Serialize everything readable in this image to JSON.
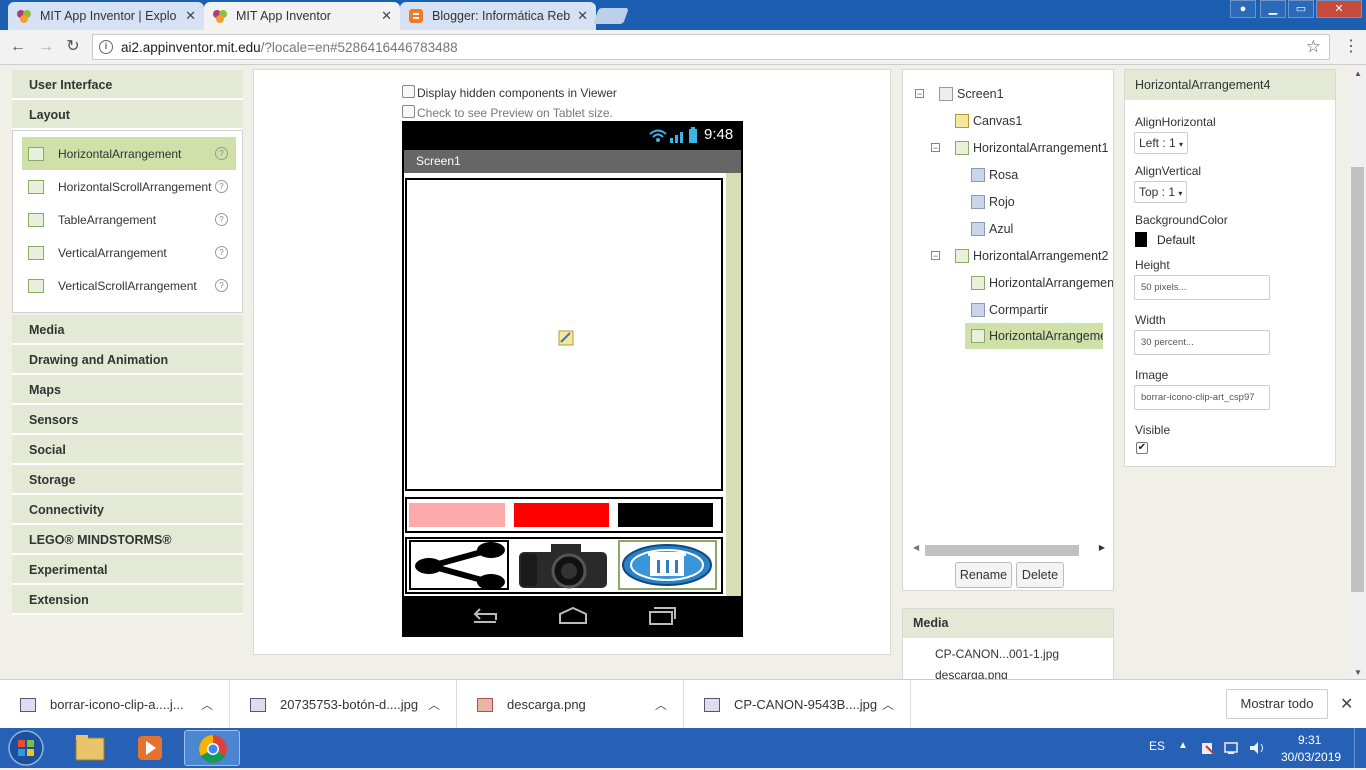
{
  "browser": {
    "tabs": [
      {
        "title": "MIT App Inventor | Explo",
        "active": false
      },
      {
        "title": "MIT App Inventor",
        "active": true
      },
      {
        "title": "Blogger: Informática Reb",
        "active": false
      }
    ],
    "url_host": "ai2.appinventor.mit.edu",
    "url_rest": "/?locale=en#5286416446783488"
  },
  "palette": {
    "categories_top": [
      "User Interface",
      "Layout"
    ],
    "layout_items": [
      "HorizontalArrangement",
      "HorizontalScrollArrangement",
      "TableArrangement",
      "VerticalArrangement",
      "VerticalScrollArrangement"
    ],
    "help_glyph": "?",
    "categories_bottom": [
      "Media",
      "Drawing and Animation",
      "Maps",
      "Sensors",
      "Social",
      "Storage",
      "Connectivity",
      "LEGO® MINDSTORMS®",
      "Experimental",
      "Extension"
    ]
  },
  "viewer": {
    "display_hidden": "Display hidden components in Viewer",
    "tablet_preview": "Check to see Preview on Tablet size.",
    "phone_time": "9:48",
    "screen_title": "Screen1",
    "button_colors": [
      "#ffaaaa",
      "#ff0000",
      "#000000"
    ]
  },
  "tree": {
    "nodes": [
      "Screen1",
      "Canvas1",
      "HorizontalArrangement1",
      "Rosa",
      "Rojo",
      "Azul",
      "HorizontalArrangement2",
      "HorizontalArrangemen",
      "Cormpartir",
      "HorizontalArrangemen"
    ],
    "toggle_glyph": "−",
    "rename": "Rename",
    "delete": "Delete"
  },
  "media": {
    "header": "Media",
    "items": [
      "CP-CANON...001-1.jpg",
      "descarga.png"
    ]
  },
  "properties": {
    "header": "HorizontalArrangement4",
    "align_h_label": "AlignHorizontal",
    "align_h_value": "Left : 1",
    "align_v_label": "AlignVertical",
    "align_v_value": "Top : 1",
    "bg_label": "BackgroundColor",
    "bg_value": "Default",
    "height_label": "Height",
    "height_value": "50 pixels...",
    "width_label": "Width",
    "width_value": "30 percent...",
    "image_label": "Image",
    "image_value": "borrar-icono-clip-art_csp97",
    "visible_label": "Visible",
    "visible": true
  },
  "downloads": {
    "items": [
      "borrar-icono-clip-a....j...",
      "20735753-botón-d....jpg",
      "descarga.png",
      "CP-CANON-9543B....jpg"
    ],
    "show_all": "Mostrar todo"
  },
  "taskbar": {
    "lang": "ES",
    "time": "9:31",
    "date": "30/03/2019"
  }
}
